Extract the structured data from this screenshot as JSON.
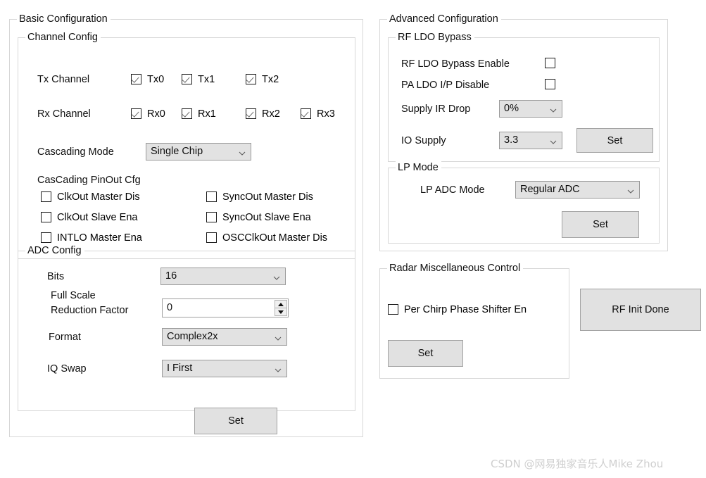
{
  "basic": {
    "title": "Basic Configuration",
    "channel_config": {
      "title": "Channel Config",
      "tx_label": "Tx Channel",
      "rx_label": "Rx Channel",
      "tx_channels": [
        {
          "label": "Tx0",
          "checked": true
        },
        {
          "label": "Tx1",
          "checked": true
        },
        {
          "label": "Tx2",
          "checked": true
        }
      ],
      "rx_channels": [
        {
          "label": "Rx0",
          "checked": true
        },
        {
          "label": "Rx1",
          "checked": true
        },
        {
          "label": "Rx2",
          "checked": true
        },
        {
          "label": "Rx3",
          "checked": true
        }
      ],
      "cascading_mode_label": "Cascading Mode",
      "cascading_mode_value": "Single Chip",
      "cascading_mode_options": [
        "Single Chip"
      ],
      "pinout_label": "CasCading PinOut Cfg",
      "pinout_checkboxes": [
        {
          "label": "ClkOut Master Dis",
          "checked": false
        },
        {
          "label": "SyncOut Master Dis",
          "checked": false
        },
        {
          "label": "ClkOut Slave Ena",
          "checked": false
        },
        {
          "label": "SyncOut Slave Ena",
          "checked": false
        },
        {
          "label": "INTLO Master Ena",
          "checked": false
        },
        {
          "label": "OSCClkOut Master Dis",
          "checked": false
        }
      ]
    },
    "adc_config": {
      "title": "ADC Config",
      "bits_label": "Bits",
      "bits_value": "16",
      "bits_options": [
        "16"
      ],
      "full_scale_label_line1": "Full Scale",
      "full_scale_label_line2": "Reduction Factor",
      "full_scale_value": "0",
      "format_label": "Format",
      "format_value": "Complex2x",
      "format_options": [
        "Complex2x"
      ],
      "iq_swap_label": "IQ Swap",
      "iq_swap_value": "I First",
      "iq_swap_options": [
        "I First"
      ]
    },
    "set_button": "Set"
  },
  "advanced": {
    "title": "Advanced Configuration",
    "rf_ldo_bypass": {
      "title": "RF LDO Bypass",
      "bypass_enable_label": "RF LDO Bypass Enable",
      "bypass_enable_checked": false,
      "pa_ldo_label": "PA LDO I/P Disable",
      "pa_ldo_checked": false,
      "supply_ir_drop_label": "Supply IR Drop",
      "supply_ir_drop_value": "0%",
      "supply_ir_drop_options": [
        "0%"
      ],
      "io_supply_label": "IO Supply",
      "io_supply_value": "3.3",
      "io_supply_options": [
        "3.3"
      ],
      "set_button": "Set"
    },
    "lp_mode": {
      "title": "LP Mode",
      "lp_adc_mode_label": "LP ADC Mode",
      "lp_adc_mode_value": "Regular ADC",
      "lp_adc_mode_options": [
        "Regular ADC"
      ],
      "set_button": "Set"
    }
  },
  "radar_misc": {
    "title": "Radar Miscellaneous Control",
    "per_chirp_label": "Per Chirp Phase Shifter En",
    "per_chirp_checked": false,
    "set_button": "Set"
  },
  "rf_init_done_button": "RF Init Done",
  "watermark": "CSDN @网易独家音乐人Mike Zhou",
  "colors": {
    "group_border": "#d7d7d7",
    "control_fill": "#e1e1e1",
    "control_border": "#a0a0a0",
    "text": "#0f0f0f",
    "watermark": "#cfcfcf"
  }
}
